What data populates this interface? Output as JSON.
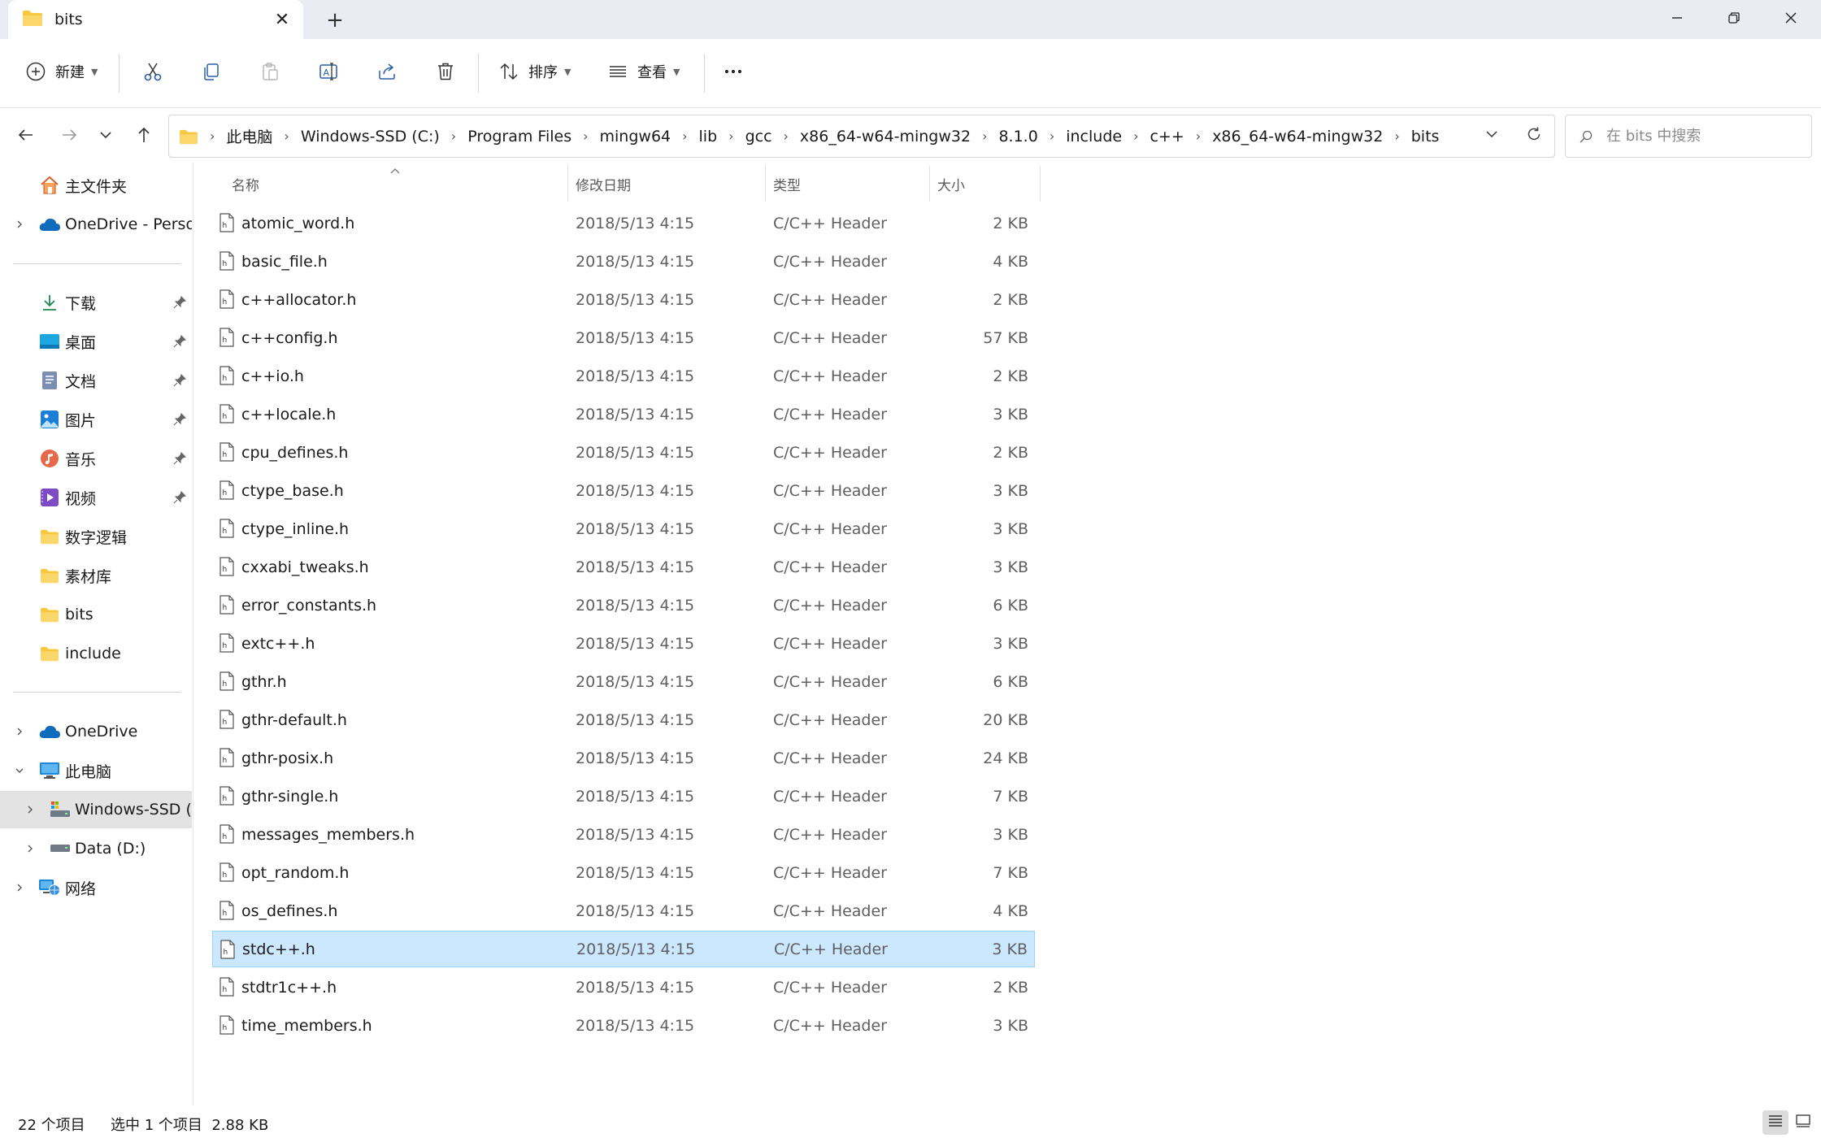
{
  "window": {
    "tab_title": "bits",
    "new_tab": "+",
    "close_tab": "✕"
  },
  "toolbar": {
    "new_label": "新建",
    "sort_label": "排序",
    "view_label": "查看"
  },
  "address": {
    "breadcrumbs": [
      "此电脑",
      "Windows-SSD (C:)",
      "Program Files",
      "mingw64",
      "lib",
      "gcc",
      "x86_64-w64-mingw32",
      "8.1.0",
      "include",
      "c++",
      "x86_64-w64-mingw32",
      "bits"
    ],
    "search_placeholder": "在 bits 中搜索"
  },
  "sidebar": {
    "home": "主文件夹",
    "onedrive_personal": "OneDrive - Persor",
    "quick": [
      {
        "label": "下载",
        "icon": "download-icon"
      },
      {
        "label": "桌面",
        "icon": "desktop-icon"
      },
      {
        "label": "文档",
        "icon": "document-icon"
      },
      {
        "label": "图片",
        "icon": "picture-icon"
      },
      {
        "label": "音乐",
        "icon": "music-icon"
      },
      {
        "label": "视频",
        "icon": "video-icon"
      },
      {
        "label": "数字逻辑",
        "icon": "folder-icon"
      },
      {
        "label": "素材库",
        "icon": "folder-icon"
      },
      {
        "label": "bits",
        "icon": "folder-icon"
      },
      {
        "label": "include",
        "icon": "folder-icon"
      }
    ],
    "onedrive": "OneDrive",
    "this_pc": "此电脑",
    "drive_c": "Windows-SSD (C",
    "drive_d": "Data (D:)",
    "network": "网络"
  },
  "columns": {
    "name": "名称",
    "date": "修改日期",
    "type": "类型",
    "size": "大小"
  },
  "files": [
    {
      "name": "atomic_word.h",
      "date": "2018/5/13 4:15",
      "type": "C/C++ Header",
      "size": "2 KB"
    },
    {
      "name": "basic_file.h",
      "date": "2018/5/13 4:15",
      "type": "C/C++ Header",
      "size": "4 KB"
    },
    {
      "name": "c++allocator.h",
      "date": "2018/5/13 4:15",
      "type": "C/C++ Header",
      "size": "2 KB"
    },
    {
      "name": "c++config.h",
      "date": "2018/5/13 4:15",
      "type": "C/C++ Header",
      "size": "57 KB"
    },
    {
      "name": "c++io.h",
      "date": "2018/5/13 4:15",
      "type": "C/C++ Header",
      "size": "2 KB"
    },
    {
      "name": "c++locale.h",
      "date": "2018/5/13 4:15",
      "type": "C/C++ Header",
      "size": "3 KB"
    },
    {
      "name": "cpu_defines.h",
      "date": "2018/5/13 4:15",
      "type": "C/C++ Header",
      "size": "2 KB"
    },
    {
      "name": "ctype_base.h",
      "date": "2018/5/13 4:15",
      "type": "C/C++ Header",
      "size": "3 KB"
    },
    {
      "name": "ctype_inline.h",
      "date": "2018/5/13 4:15",
      "type": "C/C++ Header",
      "size": "3 KB"
    },
    {
      "name": "cxxabi_tweaks.h",
      "date": "2018/5/13 4:15",
      "type": "C/C++ Header",
      "size": "3 KB"
    },
    {
      "name": "error_constants.h",
      "date": "2018/5/13 4:15",
      "type": "C/C++ Header",
      "size": "6 KB"
    },
    {
      "name": "extc++.h",
      "date": "2018/5/13 4:15",
      "type": "C/C++ Header",
      "size": "3 KB"
    },
    {
      "name": "gthr.h",
      "date": "2018/5/13 4:15",
      "type": "C/C++ Header",
      "size": "6 KB"
    },
    {
      "name": "gthr-default.h",
      "date": "2018/5/13 4:15",
      "type": "C/C++ Header",
      "size": "20 KB"
    },
    {
      "name": "gthr-posix.h",
      "date": "2018/5/13 4:15",
      "type": "C/C++ Header",
      "size": "24 KB"
    },
    {
      "name": "gthr-single.h",
      "date": "2018/5/13 4:15",
      "type": "C/C++ Header",
      "size": "7 KB"
    },
    {
      "name": "messages_members.h",
      "date": "2018/5/13 4:15",
      "type": "C/C++ Header",
      "size": "3 KB"
    },
    {
      "name": "opt_random.h",
      "date": "2018/5/13 4:15",
      "type": "C/C++ Header",
      "size": "7 KB"
    },
    {
      "name": "os_defines.h",
      "date": "2018/5/13 4:15",
      "type": "C/C++ Header",
      "size": "4 KB"
    },
    {
      "name": "stdc++.h",
      "date": "2018/5/13 4:15",
      "type": "C/C++ Header",
      "size": "3 KB",
      "selected": true
    },
    {
      "name": "stdtr1c++.h",
      "date": "2018/5/13 4:15",
      "type": "C/C++ Header",
      "size": "2 KB"
    },
    {
      "name": "time_members.h",
      "date": "2018/5/13 4:15",
      "type": "C/C++ Header",
      "size": "3 KB"
    }
  ],
  "status": {
    "item_count": "22 个项目",
    "selection": "选中 1 个项目  2.88 KB"
  },
  "colors": {
    "selection_bg": "#cce8ff",
    "selection_border": "#99d1ff",
    "folder_yellow": "#f8c842",
    "accent_blue": "#0067c0"
  }
}
